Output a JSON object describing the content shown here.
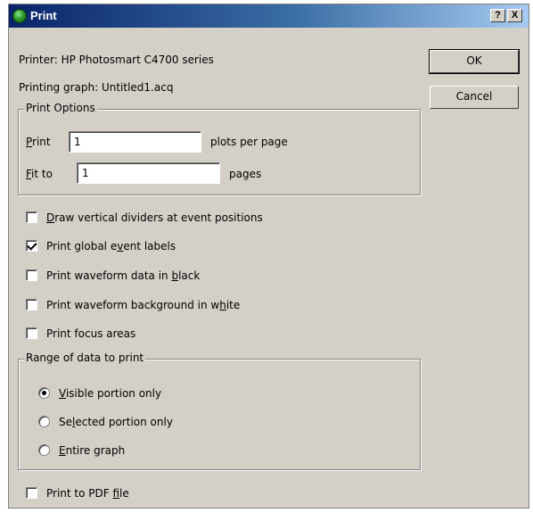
{
  "window": {
    "title": "Print",
    "help_glyph": "?",
    "close_glyph": "X"
  },
  "info": {
    "printer": "Printer: HP Photosmart C4700 series",
    "graph": "Printing graph: Untitled1.acq"
  },
  "buttons": {
    "ok": "OK",
    "cancel": "Cancel"
  },
  "print_options": {
    "legend": "Print Options",
    "print_label": "Print",
    "print_value": "1",
    "print_suffix": "plots per page",
    "fit_label": "Fit to",
    "fit_value": "1",
    "fit_suffix": "pages"
  },
  "checkboxes": [
    {
      "label": "Draw vertical dividers at event positions",
      "checked": false
    },
    {
      "label": "Print global event labels",
      "checked": true
    },
    {
      "label": "Print waveform data in black",
      "checked": false
    },
    {
      "label": "Print waveform background in white",
      "checked": false
    },
    {
      "label": "Print focus areas",
      "checked": false
    }
  ],
  "range": {
    "legend": "Range of data to print",
    "options": [
      {
        "label": "Visible portion only",
        "selected": true
      },
      {
        "label": "Selected portion only",
        "selected": false
      },
      {
        "label": "Entire graph",
        "selected": false
      }
    ]
  },
  "pdf": {
    "label": "Print to PDF file",
    "checked": false
  }
}
